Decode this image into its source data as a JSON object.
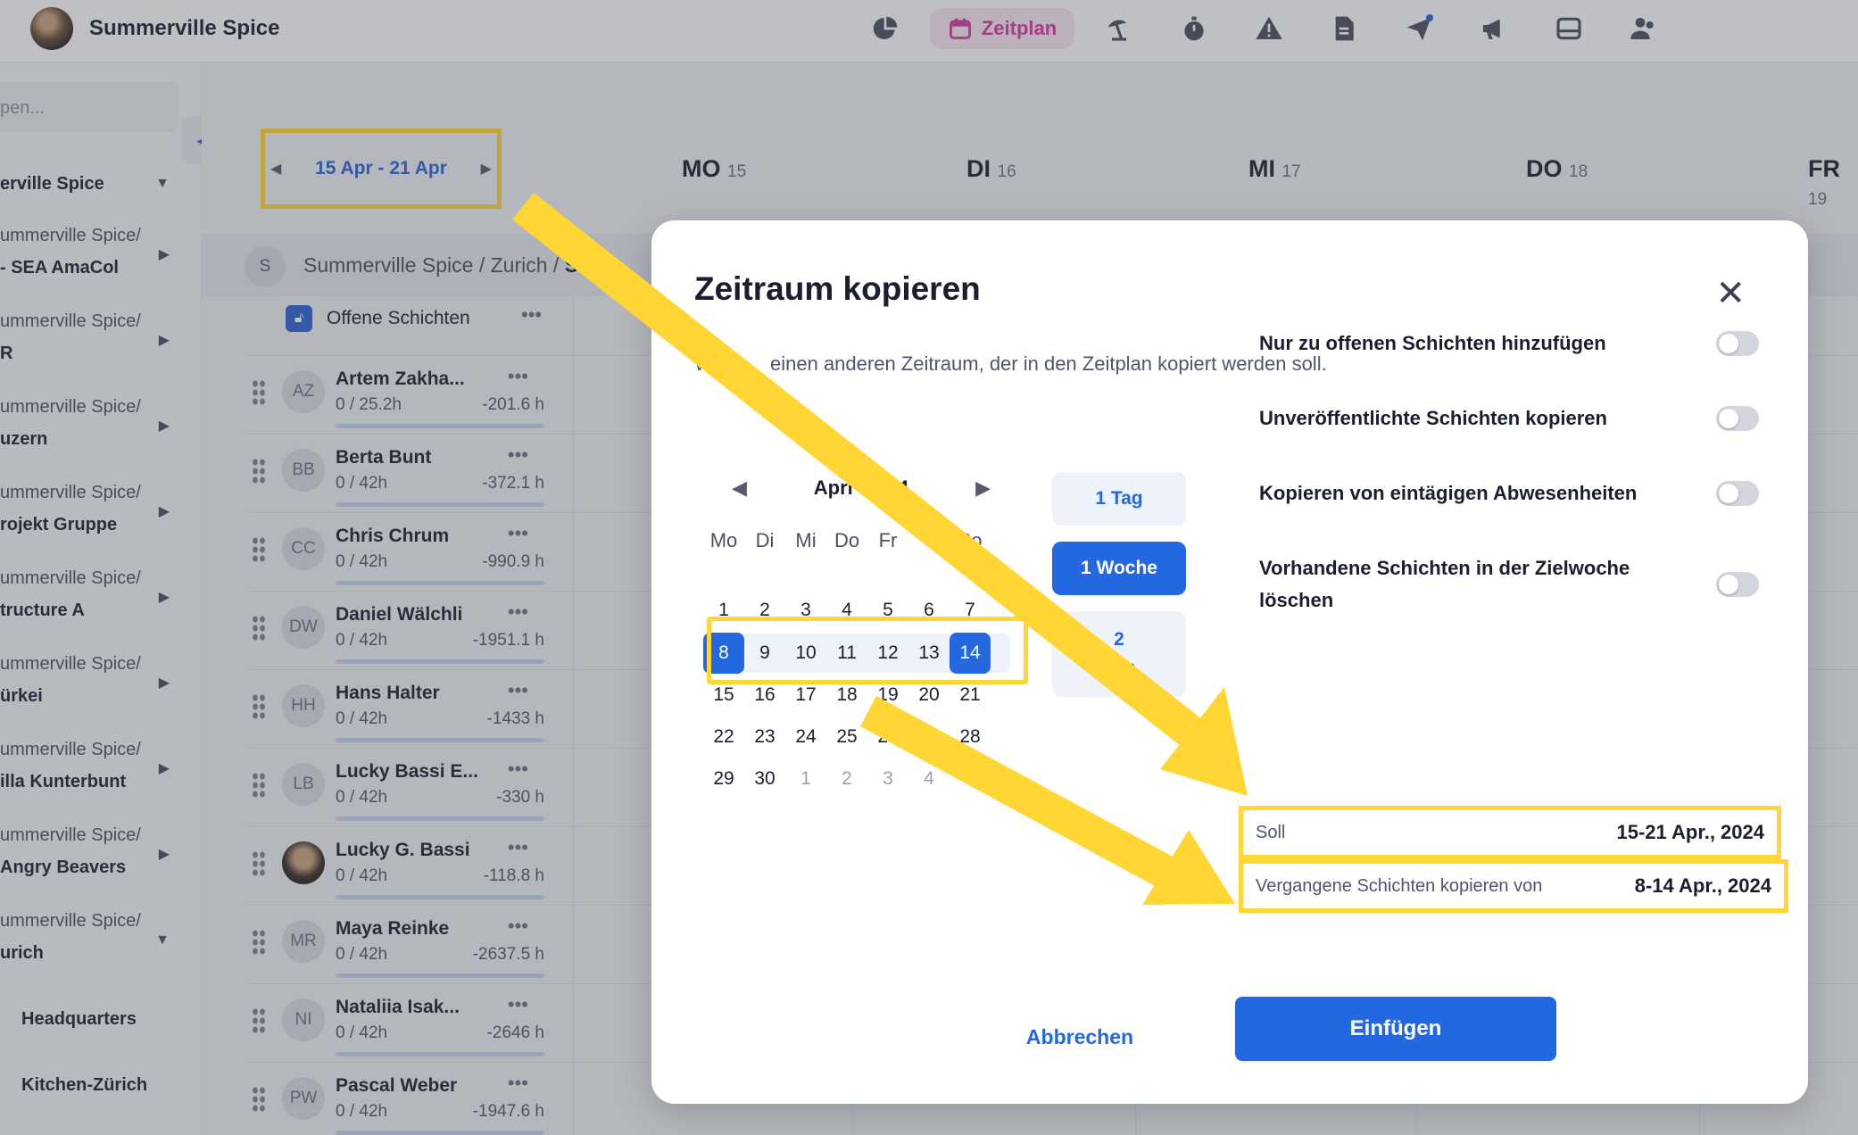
{
  "app": {
    "brand": "Summerville Spice",
    "nav_active": "Zeitplan"
  },
  "sidebar": {
    "search_placeholder": "pen...",
    "items": [
      {
        "l1": "erville Spice",
        "l2": ""
      },
      {
        "l1": "ummerville Spice/",
        "l2": "- SEA AmaCol"
      },
      {
        "l1": "ummerville Spice/",
        "l2": "R"
      },
      {
        "l1": "ummerville Spice/",
        "l2": "uzern"
      },
      {
        "l1": "ummerville Spice/",
        "l2": "rojekt Gruppe"
      },
      {
        "l1": "ummerville Spice/",
        "l2": "tructure A"
      },
      {
        "l1": "ummerville Spice/",
        "l2": "ürkei"
      },
      {
        "l1": "ummerville Spice/",
        "l2": "illa Kunterbunt"
      },
      {
        "l1": "ummerville Spice/",
        "l2": "Angry Beavers"
      },
      {
        "l1": "ummerville Spice/",
        "l2": "urich"
      },
      {
        "l1": "Headquarters",
        "l2": ""
      },
      {
        "l1": "Kitchen-Zürich",
        "l2": ""
      }
    ]
  },
  "schedule": {
    "week_range": "15 Apr - 21 Apr",
    "days": [
      {
        "name": "MO",
        "num": "15"
      },
      {
        "name": "DI",
        "num": "16"
      },
      {
        "name": "MI",
        "num": "17"
      },
      {
        "name": "DO",
        "num": "18"
      },
      {
        "name": "FR",
        "num": "19"
      }
    ],
    "group_initial": "S",
    "group_path": "Summerville Spice / Zurich / ",
    "group_path_bold": "Serv",
    "open_shifts": "Offene Schichten",
    "employees": [
      {
        "initials": "AZ",
        "name": "Artem Zakha...",
        "hours": "0 / 25.2h",
        "balance": "-201.6 h"
      },
      {
        "initials": "BB",
        "name": "Berta Bunt",
        "hours": "0 / 42h",
        "balance": "-372.1 h"
      },
      {
        "initials": "CC",
        "name": "Chris Chrum",
        "hours": "0 / 42h",
        "balance": "-990.9 h"
      },
      {
        "initials": "DW",
        "name": "Daniel Wälchli",
        "hours": "0 / 42h",
        "balance": "-1951.1 h"
      },
      {
        "initials": "HH",
        "name": "Hans Halter",
        "hours": "0 / 42h",
        "balance": "-1433 h"
      },
      {
        "initials": "LB",
        "name": "Lucky Bassi E...",
        "hours": "0 / 42h",
        "balance": "-330 h"
      },
      {
        "initials": "",
        "name": "Lucky G. Bassi",
        "hours": "0 / 42h",
        "balance": "-118.8 h"
      },
      {
        "initials": "MR",
        "name": "Maya Reinke",
        "hours": "0 / 42h",
        "balance": "-2637.5 h"
      },
      {
        "initials": "NI",
        "name": "Nataliia Isak...",
        "hours": "0 / 42h",
        "balance": "-2646 h"
      },
      {
        "initials": "PW",
        "name": "Pascal Weber",
        "hours": "0 / 42h",
        "balance": "-1947.6 h"
      }
    ]
  },
  "modal": {
    "title": "Zeitraum kopieren",
    "subtitle_a": "Wä",
    "subtitle_b": "einen anderen Zeitraum, der in den Zeitplan kopiert werden soll.",
    "calendar": {
      "month_a": "Apri",
      "month_b": "24",
      "weekdays": [
        "Mo",
        "Di",
        "Mi",
        "Do",
        "Fr",
        "",
        "So"
      ],
      "weeks": [
        [
          "1",
          "2",
          "3",
          "4",
          "5",
          "6",
          "7"
        ],
        [
          "8",
          "9",
          "10",
          "11",
          "12",
          "13",
          "14"
        ],
        [
          "15",
          "16",
          "17",
          "18",
          "19",
          "20",
          "21"
        ],
        [
          "22",
          "23",
          "24",
          "25",
          "26",
          "27",
          "28"
        ],
        [
          "29",
          "30",
          "1",
          "2",
          "3",
          "4",
          "5"
        ]
      ]
    },
    "range_options": [
      {
        "label": "1 Tag"
      },
      {
        "label": "1 Woche"
      },
      {
        "label": "2\nhen"
      }
    ],
    "options": [
      {
        "label": "Nur zu offenen Schichten hinzufügen",
        "on": false
      },
      {
        "label": "Unveröffentlichte Schichten kopieren",
        "on": false
      },
      {
        "label": "Kopieren von eintägigen Abwesenheiten",
        "on": false
      },
      {
        "label": "Vorhandene Schichten in der Zielwoche löschen",
        "on": false
      }
    ],
    "summary": {
      "soll_label": "Soll",
      "soll_value": "15-21 Apr., 2024",
      "past_label": "Vergangene Schichten kopieren von",
      "past_value": "8-14 Apr., 2024"
    },
    "cancel_label": "Abbrechen",
    "insert_label": "Einfügen"
  },
  "colors": {
    "accent": "#2368e0",
    "highlight": "#ffd633",
    "zeitplan": "#d63aa0"
  }
}
